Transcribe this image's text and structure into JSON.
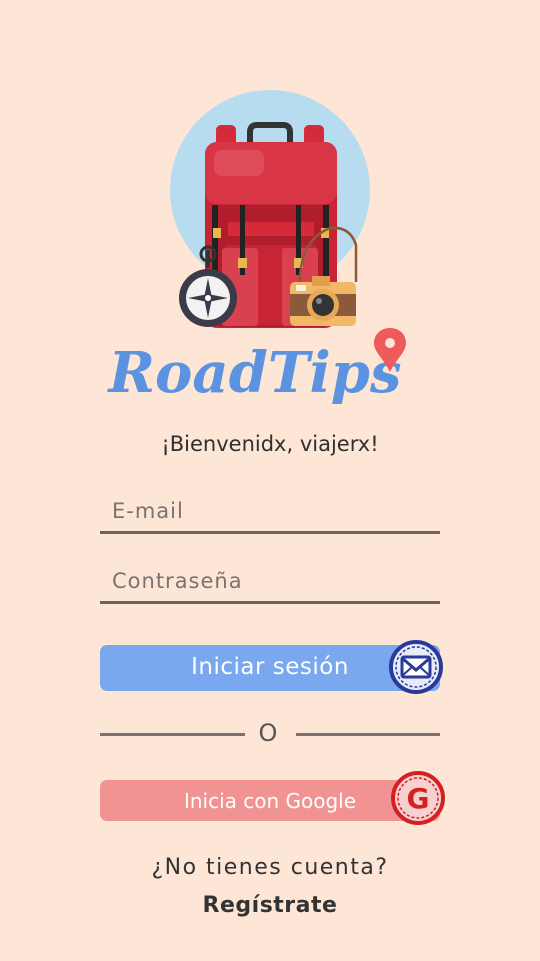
{
  "app": {
    "logo_text": "RoadTips",
    "welcome": "¡Bienvenidx, viajerx!"
  },
  "form": {
    "email_placeholder": "E-mail",
    "password_placeholder": "Contraseña",
    "login_label": "Iniciar sesión",
    "divider_label": "O",
    "google_label": "Inicia con Google"
  },
  "signup": {
    "question": "¿No tienes cuenta?",
    "link_label": "Regístrate"
  },
  "icons": {
    "hero": "backpack-compass-camera-illustration",
    "logo_pin": "map-pin-icon",
    "login_stamp": "envelope-icon",
    "google_stamp": "google-icon"
  },
  "colors": {
    "background": "#fde6d6",
    "login_button": "#7aa8ee",
    "google_button": "#f29393",
    "logo": "#5b93e0",
    "pin": "#ef5a5a"
  }
}
